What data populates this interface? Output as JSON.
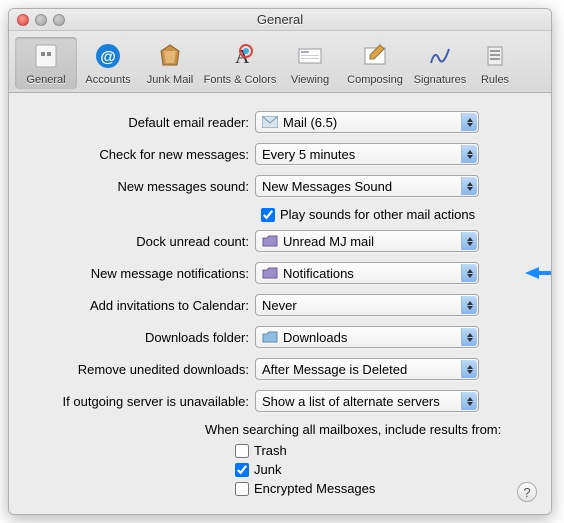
{
  "window": {
    "title": "General"
  },
  "toolbar": {
    "items": [
      {
        "label": "General"
      },
      {
        "label": "Accounts"
      },
      {
        "label": "Junk Mail"
      },
      {
        "label": "Fonts & Colors"
      },
      {
        "label": "Viewing"
      },
      {
        "label": "Composing"
      },
      {
        "label": "Signatures"
      },
      {
        "label": "Rules"
      }
    ]
  },
  "form": {
    "default_reader": {
      "label": "Default email reader:",
      "value": "Mail (6.5)"
    },
    "check_messages": {
      "label": "Check for new messages:",
      "value": "Every 5 minutes"
    },
    "new_sound": {
      "label": "New messages sound:",
      "value": "New Messages Sound"
    },
    "play_sounds": {
      "label": "Play sounds for other mail actions",
      "checked": true
    },
    "dock_unread": {
      "label": "Dock unread count:",
      "value": "Unread MJ mail"
    },
    "notifications": {
      "label": "New message notifications:",
      "value": "Notifications"
    },
    "invitations": {
      "label": "Add invitations to Calendar:",
      "value": "Never"
    },
    "downloads": {
      "label": "Downloads folder:",
      "value": "Downloads"
    },
    "remove_downloads": {
      "label": "Remove unedited downloads:",
      "value": "After Message is Deleted"
    },
    "outgoing": {
      "label": "If outgoing server is unavailable:",
      "value": "Show a list of alternate servers"
    },
    "search_heading": "When searching all mailboxes, include results from:",
    "search_trash": {
      "label": "Trash",
      "checked": false
    },
    "search_junk": {
      "label": "Junk",
      "checked": true
    },
    "search_encrypted": {
      "label": "Encrypted Messages",
      "checked": false
    }
  }
}
